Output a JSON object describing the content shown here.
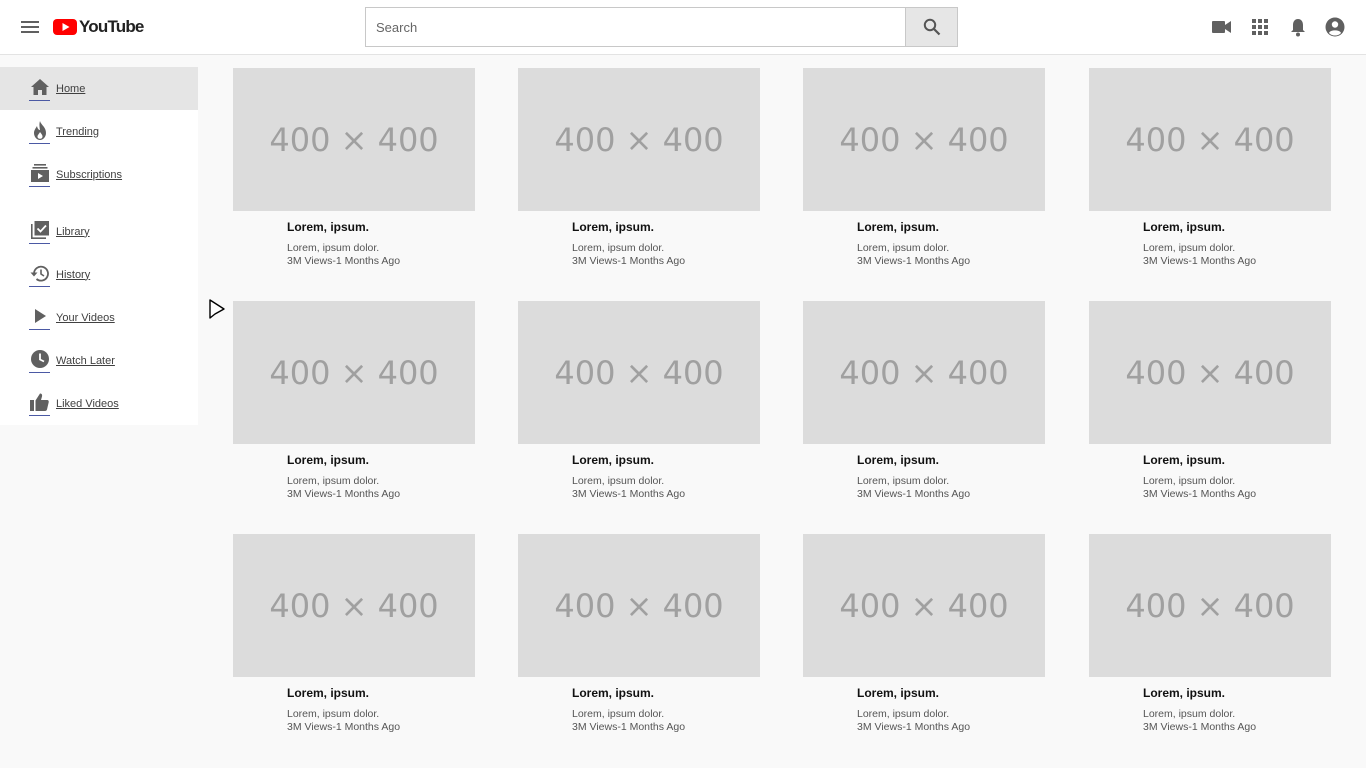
{
  "header": {
    "logo_text": "YouTube",
    "search_placeholder": "Search"
  },
  "icons": {
    "menu": "hamburger-menu-icon",
    "search": "search-icon",
    "upload": "video-camera-icon",
    "apps": "apps-grid-icon",
    "notifications": "bell-icon",
    "account": "account-circle-icon"
  },
  "colors": {
    "brand_red": "#ff0000",
    "sidebar_underline": "#4b59a4",
    "thumb_bg": "#dcdcdc"
  },
  "sidebar": {
    "items": [
      {
        "label": "Home",
        "icon": "home-icon",
        "active": true
      },
      {
        "label": "Trending",
        "icon": "flame-icon",
        "active": false
      },
      {
        "label": "Subscriptions",
        "icon": "subscriptions-icon",
        "active": false
      },
      {
        "label": "Library",
        "icon": "library-icon",
        "active": false
      },
      {
        "label": "History",
        "icon": "history-icon",
        "active": false
      },
      {
        "label": "Your Videos",
        "icon": "play-icon",
        "active": false
      },
      {
        "label": "Watch Later",
        "icon": "clock-icon",
        "active": false
      },
      {
        "label": "Liked Videos",
        "icon": "thumbs-up-icon",
        "active": false
      }
    ]
  },
  "videos": [
    {
      "thumb": "400 × 400",
      "title": "Lorem, ipsum.",
      "channel": "Lorem, ipsum dolor.",
      "meta": "3M Views-1 Months Ago"
    },
    {
      "thumb": "400 × 400",
      "title": "Lorem, ipsum.",
      "channel": "Lorem, ipsum dolor.",
      "meta": "3M Views-1 Months Ago"
    },
    {
      "thumb": "400 × 400",
      "title": "Lorem, ipsum.",
      "channel": "Lorem, ipsum dolor.",
      "meta": "3M Views-1 Months Ago"
    },
    {
      "thumb": "400 × 400",
      "title": "Lorem, ipsum.",
      "channel": "Lorem, ipsum dolor.",
      "meta": "3M Views-1 Months Ago"
    },
    {
      "thumb": "400 × 400",
      "title": "Lorem, ipsum.",
      "channel": "Lorem, ipsum dolor.",
      "meta": "3M Views-1 Months Ago"
    },
    {
      "thumb": "400 × 400",
      "title": "Lorem, ipsum.",
      "channel": "Lorem, ipsum dolor.",
      "meta": "3M Views-1 Months Ago"
    },
    {
      "thumb": "400 × 400",
      "title": "Lorem, ipsum.",
      "channel": "Lorem, ipsum dolor.",
      "meta": "3M Views-1 Months Ago"
    },
    {
      "thumb": "400 × 400",
      "title": "Lorem, ipsum.",
      "channel": "Lorem, ipsum dolor.",
      "meta": "3M Views-1 Months Ago"
    },
    {
      "thumb": "400 × 400",
      "title": "Lorem, ipsum.",
      "channel": "Lorem, ipsum dolor.",
      "meta": "3M Views-1 Months Ago"
    },
    {
      "thumb": "400 × 400",
      "title": "Lorem, ipsum.",
      "channel": "Lorem, ipsum dolor.",
      "meta": "3M Views-1 Months Ago"
    },
    {
      "thumb": "400 × 400",
      "title": "Lorem, ipsum.",
      "channel": "Lorem, ipsum dolor.",
      "meta": "3M Views-1 Months Ago"
    },
    {
      "thumb": "400 × 400",
      "title": "Lorem, ipsum.",
      "channel": "Lorem, ipsum dolor.",
      "meta": "3M Views-1 Months Ago"
    }
  ]
}
